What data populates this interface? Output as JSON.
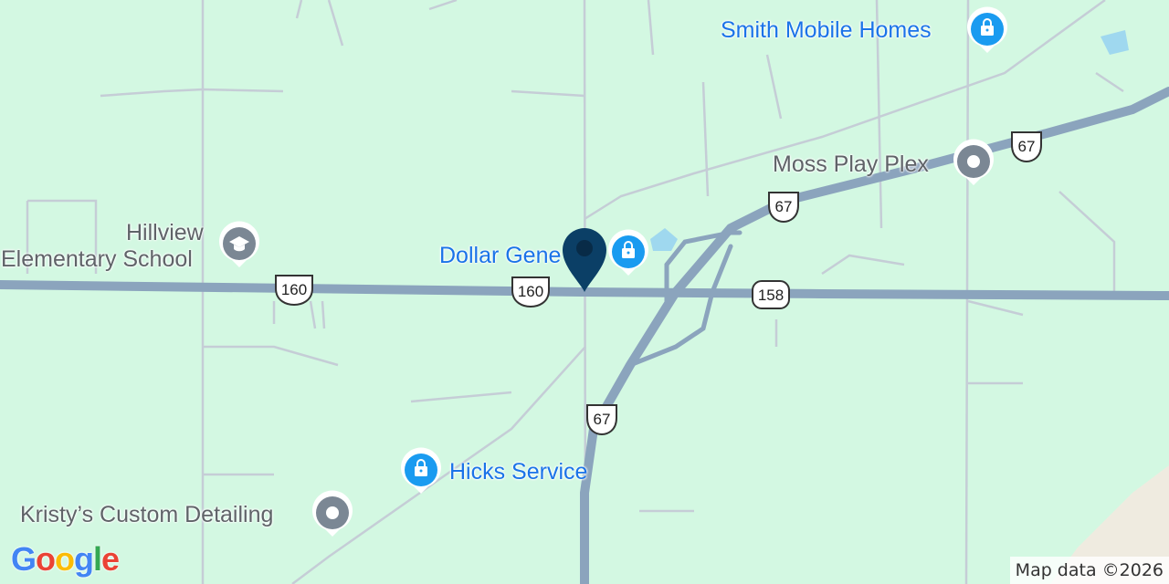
{
  "map": {
    "places": {
      "smith": "Smith Mobile Homes",
      "moss": "Moss Play Plex",
      "hillview_line1": "Hillview",
      "hillview_line2": "Elementary School",
      "dollar": "Dollar Gene",
      "hicks": "Hicks Service",
      "kristy": "Kristy’s Custom Detailing"
    },
    "shields": {
      "us160_west": "160",
      "us160_center": "160",
      "us158": "158",
      "us67_north": "67",
      "us67_mid": "67",
      "us67_south": "67"
    },
    "icons": {
      "shopping": "shopping-bag-icon",
      "school": "graduation-cap-icon",
      "generic": "generic-poi-icon",
      "pin": "location-pin-icon"
    },
    "colors": {
      "land": "#d3f8e2",
      "highway": "#8ba4bd",
      "minor_road": "#c5cdd6",
      "water": "#9fd8ef",
      "blue_poi": "#1a9bf0",
      "gray_poi": "#7b8794",
      "pin": "#0b3f66"
    }
  },
  "logo": [
    "G",
    "o",
    "o",
    "g",
    "l",
    "e"
  ],
  "attribution": "Map data ©2026"
}
